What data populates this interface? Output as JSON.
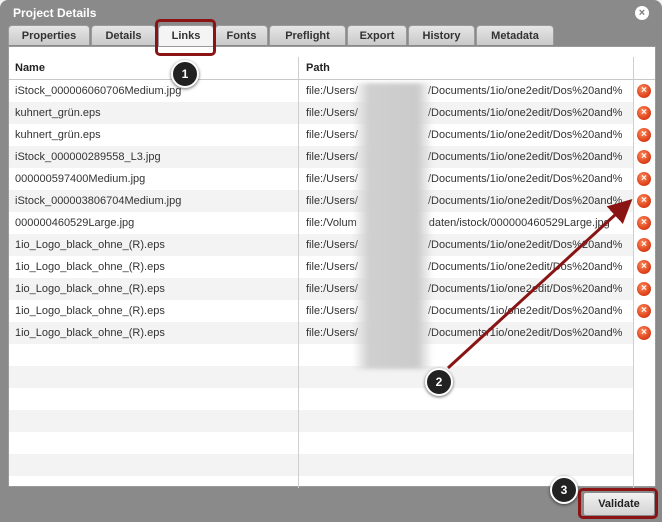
{
  "window": {
    "title": "Project Details",
    "close_glyph": "×"
  },
  "tabs": [
    {
      "label": "Properties"
    },
    {
      "label": "Details"
    },
    {
      "label": "Links"
    },
    {
      "label": "Fonts"
    },
    {
      "label": "Preflight"
    },
    {
      "label": "Export"
    },
    {
      "label": "History"
    },
    {
      "label": "Metadata"
    }
  ],
  "active_tab": "Links",
  "table": {
    "columns": [
      "Name",
      "Path"
    ],
    "rows": [
      {
        "name": "iStock_000006060706Medium.jpg",
        "path_start": "file:/Users/",
        "path_end": "/Documents/1io/one2edit/Dos%20and%"
      },
      {
        "name": "kuhnert_grün.eps",
        "path_start": "file:/Users/",
        "path_end": "/Documents/1io/one2edit/Dos%20and%"
      },
      {
        "name": "kuhnert_grün.eps",
        "path_start": "file:/Users/",
        "path_end": "/Documents/1io/one2edit/Dos%20and%"
      },
      {
        "name": "iStock_000000289558_L3.jpg",
        "path_start": "file:/Users/",
        "path_end": "/Documents/1io/one2edit/Dos%20and%"
      },
      {
        "name": "000000597400Medium.jpg",
        "path_start": "file:/Users/",
        "path_end": "/Documents/1io/one2edit/Dos%20and%"
      },
      {
        "name": "iStock_000003806704Medium.jpg",
        "path_start": "file:/Users/",
        "path_end": "/Documents/1io/one2edit/Dos%20and%"
      },
      {
        "name": "000000460529Large.jpg",
        "path_start": "file:/Volum",
        "path_end": "daten/istock/000000460529Large.jpg"
      },
      {
        "name": "1io_Logo_black_ohne_(R).eps",
        "path_start": "file:/Users/",
        "path_end": "/Documents/1io/one2edit/Dos%20and%"
      },
      {
        "name": "1io_Logo_black_ohne_(R).eps",
        "path_start": "file:/Users/",
        "path_end": "/Documents/1io/one2edit/Dos%20and%"
      },
      {
        "name": "1io_Logo_black_ohne_(R).eps",
        "path_start": "file:/Users/",
        "path_end": "/Documents/1io/one2edit/Dos%20and%"
      },
      {
        "name": "1io_Logo_black_ohne_(R).eps",
        "path_start": "file:/Users/",
        "path_end": "/Documents/1io/one2edit/Dos%20and%"
      },
      {
        "name": "1io_Logo_black_ohne_(R).eps",
        "path_start": "file:/Users/",
        "path_end": "/Documents/1io/one2edit/Dos%20and%"
      }
    ],
    "delete_glyph": "×"
  },
  "footer": {
    "validate_label": "Validate"
  },
  "callouts": [
    "1",
    "2",
    "3"
  ],
  "colors": {
    "highlight": "#8a1414",
    "delete_icon": "#e0461f",
    "dialog_bg": "#8a8a8a"
  }
}
